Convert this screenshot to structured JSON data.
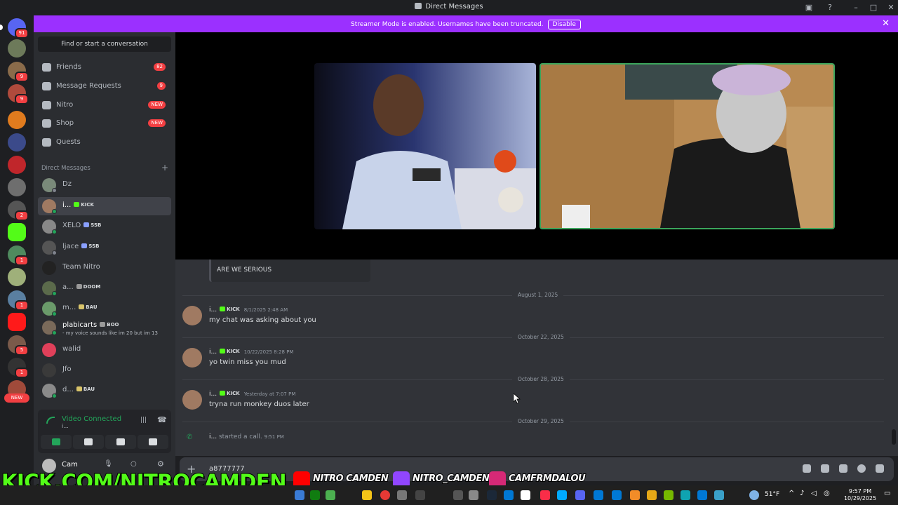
{
  "window": {
    "title": "Direct Messages"
  },
  "banner": {
    "text": "Streamer Mode is enabled. Usernames have been truncated.",
    "disable_label": "Disable"
  },
  "rail": {
    "home_badge": "91",
    "badges": [
      "",
      "9",
      "9",
      "",
      "",
      "",
      "",
      "2",
      "",
      "1",
      "",
      "1",
      "",
      "5",
      "1",
      "",
      ""
    ],
    "new_label": "NEW"
  },
  "sidebar": {
    "find_label": "Find or start a conversation",
    "nav": [
      {
        "label": "Friends",
        "badge": "82"
      },
      {
        "label": "Message Requests",
        "badge": "9"
      },
      {
        "label": "Nitro",
        "badge": "NEW"
      },
      {
        "label": "Shop",
        "badge": "NEW"
      },
      {
        "label": "Quests",
        "badge": ""
      }
    ],
    "dm_header": "Direct Messages",
    "dms": [
      {
        "name": "Dz",
        "tag": "",
        "sub": ""
      },
      {
        "name": "i...",
        "tag": "KICK",
        "sub": ""
      },
      {
        "name": "XELO",
        "tag": "SSB",
        "sub": ""
      },
      {
        "name": "ljace",
        "tag": "SSB",
        "sub": ""
      },
      {
        "name": "Team Nitro",
        "tag": "",
        "sub": ""
      },
      {
        "name": "a...",
        "tag": "DOOM",
        "sub": ""
      },
      {
        "name": "m...",
        "tag": "BAU",
        "sub": ""
      },
      {
        "name": "plabicarts",
        "tag": "BOO",
        "sub": "- my voice sounds like im 20 but im 13"
      },
      {
        "name": "walid",
        "tag": "",
        "sub": ""
      },
      {
        "name": "Jfo",
        "tag": "",
        "sub": ""
      },
      {
        "name": "d...",
        "tag": "BAU",
        "sub": ""
      }
    ],
    "voice": {
      "status": "Video Connected",
      "sub": "i..."
    },
    "user": {
      "name": "Cam"
    }
  },
  "chat": {
    "quote": "ARE WE SERIOUS",
    "dividers": [
      "August 1, 2025",
      "October 22, 2025",
      "October 28, 2025",
      "October 29, 2025"
    ],
    "messages": [
      {
        "author": "i...",
        "tag": "KICK",
        "time": "8/1/2025 2:48 AM",
        "text": "my chat was asking about you"
      },
      {
        "author": "i...",
        "tag": "KICK",
        "time": "10/22/2025 8:28 PM",
        "text": "yo twin miss you mud"
      },
      {
        "author": "i...",
        "tag": "KICK",
        "time": "Yesterday at 7:07 PM",
        "text": "tryna run monkey duos later"
      }
    ],
    "call": {
      "who": "i...",
      "action": "started a call.",
      "time": "9:51 PM"
    },
    "composer_value": "a8777777"
  },
  "overlay": {
    "kick": "KICK.COM/NITROCAMDEN",
    "youtube": "NITRO CAMDEN",
    "twitch": "NITRO_CAMDEN",
    "instagram": "CAMFRMDALOU"
  },
  "taskbar": {
    "temp": "51°F",
    "time": "9:57 PM",
    "date": "10/29/2025"
  },
  "colors": {
    "accent": "#9b30ff",
    "online": "#23a55a",
    "badge": "#f23f42",
    "kick_green": "#53fc18"
  }
}
